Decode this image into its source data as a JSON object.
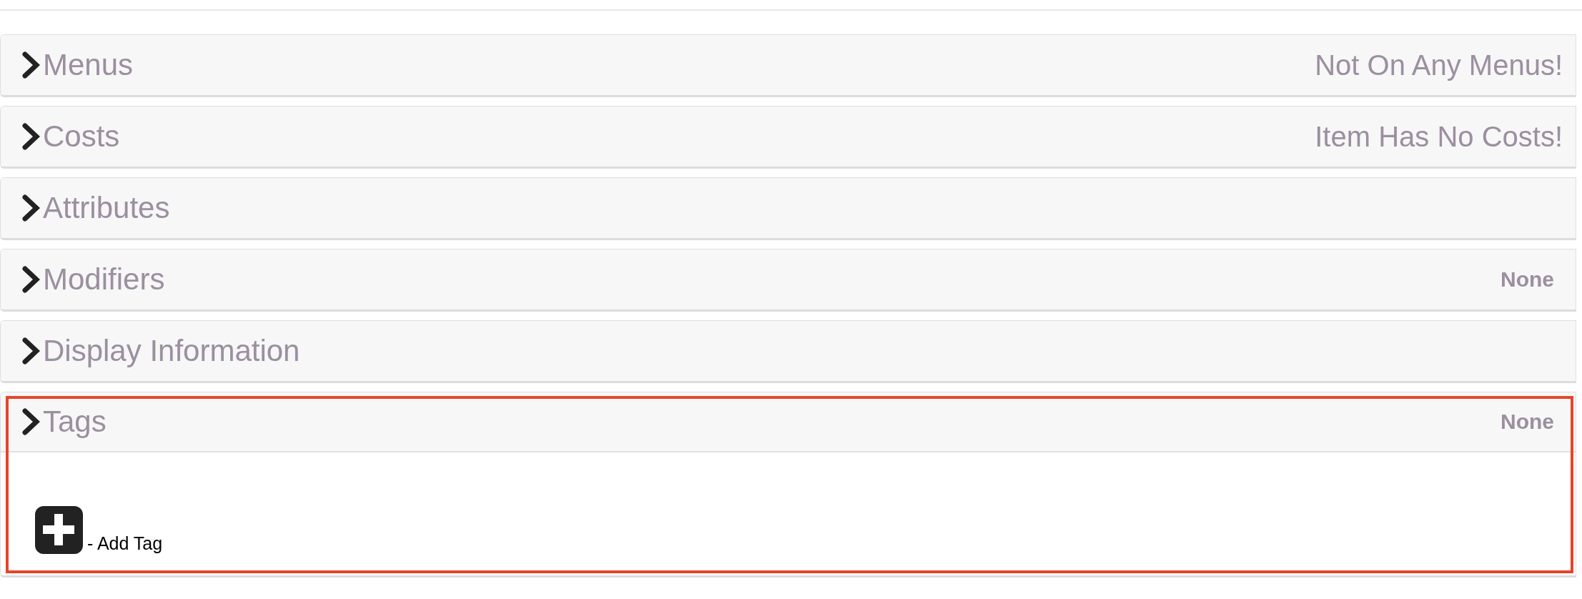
{
  "panels": [
    {
      "title": "Menus",
      "summary": {
        "text": "Not On Any Menus!",
        "kind": "message"
      },
      "expanded": false,
      "highlighted": false
    },
    {
      "title": "Costs",
      "summary": {
        "text": "Item Has No Costs!",
        "kind": "message"
      },
      "expanded": false,
      "highlighted": false
    },
    {
      "title": "Attributes",
      "expanded": false,
      "highlighted": false
    },
    {
      "title": "Modifiers",
      "summary": {
        "text": "None",
        "kind": "count"
      },
      "expanded": false,
      "highlighted": false
    },
    {
      "title": "Display Information",
      "expanded": false,
      "highlighted": false
    },
    {
      "title": "Tags",
      "summary": {
        "text": "None",
        "kind": "count"
      },
      "expanded": true,
      "highlighted": true,
      "actions": [
        {
          "label": "- Add Tag"
        }
      ]
    }
  ]
}
